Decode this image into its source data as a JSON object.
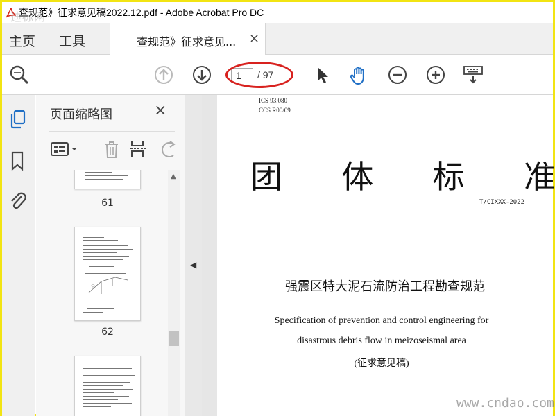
{
  "window": {
    "title": "查规范》征求意见稿2022.12.pdf - Adobe Acrobat Pro DC",
    "watermark_top": "迪标网"
  },
  "tabs": {
    "home": "主页",
    "tools": "工具",
    "doc_tab": "查规范》征求意见...",
    "close": "×"
  },
  "toolbar": {
    "current_page": "1",
    "total_pages": "/ 97",
    "icons": [
      "search-icon",
      "page-up-icon",
      "page-down-icon",
      "select-arrow-icon",
      "hand-icon",
      "zoom-out-icon",
      "zoom-in-icon",
      "keyboard-icon"
    ]
  },
  "side_rail": {
    "icons": [
      "thumbnails-icon",
      "bookmark-icon",
      "attachment-icon"
    ]
  },
  "thumbnail_panel": {
    "title": "页面缩略图",
    "close": "×",
    "pages": [
      "61",
      "62"
    ]
  },
  "document": {
    "ics": "ICS 93.080",
    "ccs": "CCS R00/09",
    "heading_chars": [
      "团",
      "体",
      "标",
      "准"
    ],
    "standard_number": "T/CIXXX-2022",
    "cn_title": "强震区特大泥石流防治工程勘查规范",
    "en_title_line1": "Specification of prevention and control engineering for",
    "en_title_line2": "disastrous debris flow in meizoseismal area",
    "draft_label": "(征求意见稿)"
  },
  "watermark_bottom": "www.cndao.com",
  "colors": {
    "accent_blue": "#1f6fc5",
    "annotation_red": "#d8221f",
    "border_yellow": "#f2e413"
  }
}
